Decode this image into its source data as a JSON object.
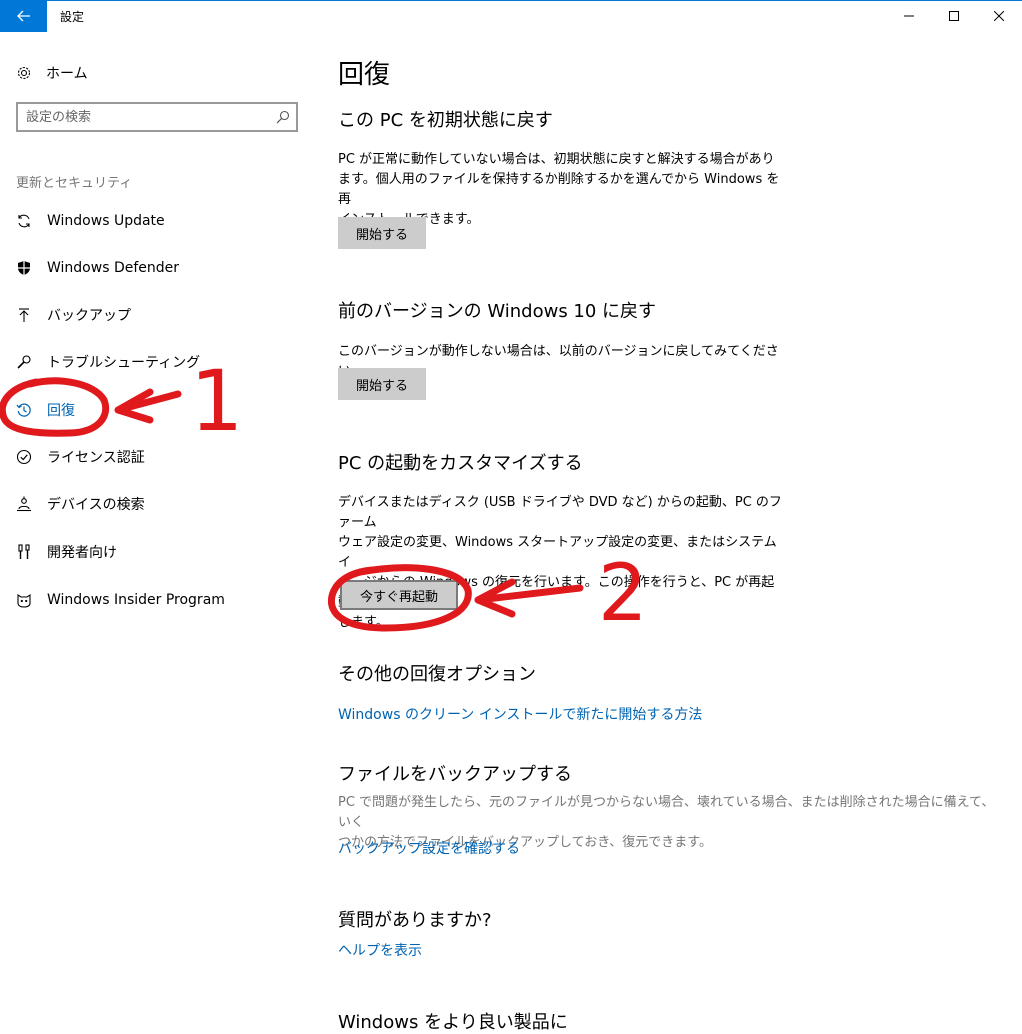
{
  "window": {
    "title": "設定",
    "back_icon": "back-arrow-icon",
    "controls": [
      "minimize-icon",
      "maximize-icon",
      "close-icon"
    ],
    "accent": "#0078d7"
  },
  "sidebar": {
    "home_label": "ホーム",
    "search_placeholder": "設定の検索",
    "group_label": "更新とセキュリティ",
    "items": [
      {
        "label": "Windows Update",
        "icon": "sync-icon"
      },
      {
        "label": "Windows Defender",
        "icon": "shield-icon"
      },
      {
        "label": "バックアップ",
        "icon": "backup-upload-icon"
      },
      {
        "label": "トラブルシューティング",
        "icon": "wrench-icon"
      },
      {
        "label": "回復",
        "icon": "history-icon",
        "selected": true
      },
      {
        "label": "ライセンス認証",
        "icon": "check-circle-icon"
      },
      {
        "label": "デバイスの検索",
        "icon": "person-pin-icon"
      },
      {
        "label": "開発者向け",
        "icon": "developer-tools-icon"
      },
      {
        "label": "Windows Insider Program",
        "icon": "insider-cat-icon"
      }
    ]
  },
  "main": {
    "title": "回復",
    "reset": {
      "heading": "この PC を初期状態に戻す",
      "lines": [
        "PC が正常に動作していない場合は、初期状態に戻すと解決する場合があり",
        "ます。個人用のファイルを保持するか削除するかを選んでから Windows を再",
        "インストールできます。"
      ],
      "button": "開始する"
    },
    "previous": {
      "heading": "前のバージョンの Windows 10 に戻す",
      "lines": [
        "このバージョンが動作しない場合は、以前のバージョンに戻してみてください。"
      ],
      "button": "開始する"
    },
    "advanced": {
      "heading": "PC の起動をカスタマイズする",
      "lines": [
        "デバイスまたはディスク (USB ドライブや DVD など) からの起動、PC のファーム",
        "ウェア設定の変更、Windows スタートアップ設定の変更、またはシステム イ",
        "メージからの Windows の復元を行います。この操作を行うと、PC が再起動",
        "します。"
      ],
      "button": "今すぐ再起動"
    },
    "more": {
      "heading": "その他の回復オプション",
      "link": "Windows のクリーン インストールで新たに開始する方法"
    },
    "backup": {
      "heading": "ファイルをバックアップする",
      "lines": [
        "PC で問題が発生したら、元のファイルが見つからない場合、壊れている場合、または削除された場合に備えて、いく",
        "つかの方法でファイルをバックアップしておき、復元できます。"
      ],
      "link": "バックアップ設定を確認する"
    },
    "question": {
      "heading": "質問がありますか?",
      "link": "ヘルプを表示"
    },
    "feedback": {
      "heading": "Windows をより良い製品に"
    }
  },
  "annotations": {
    "color": "#e0191d",
    "labels": [
      "1",
      "2"
    ]
  }
}
